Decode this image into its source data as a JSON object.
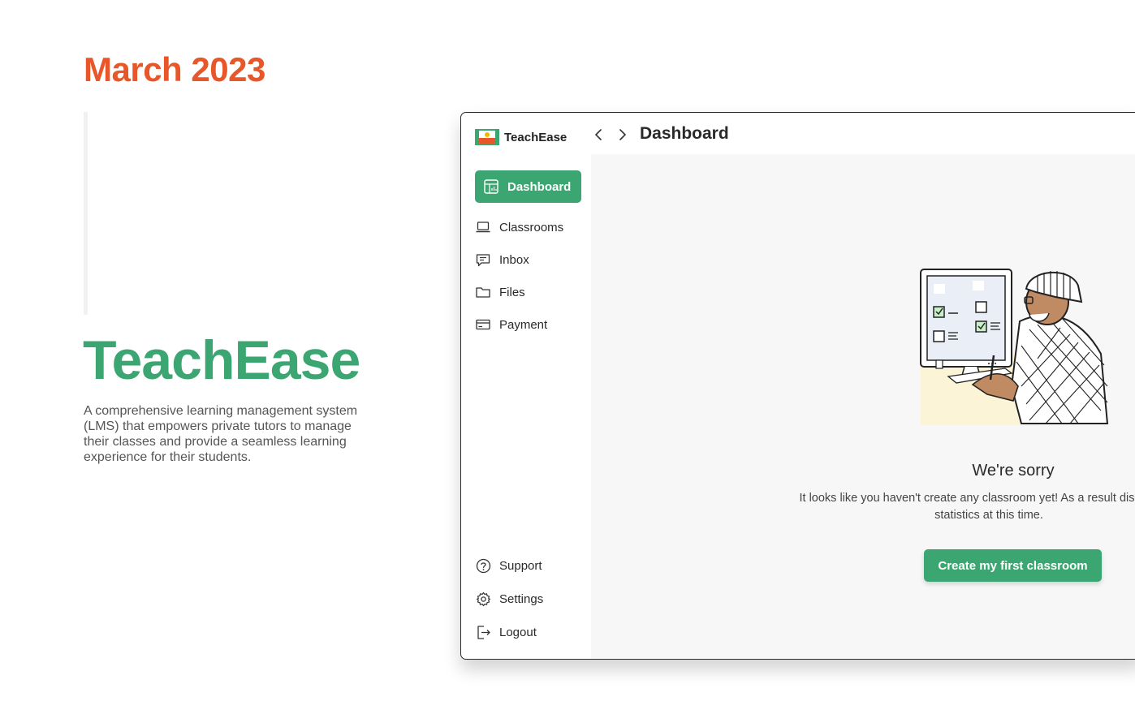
{
  "hero": {
    "date": "March 2023",
    "brand": "TeachEase",
    "description": "A comprehensive learning management system (LMS) that empowers private tutors to manage their classes and provide a seamless learning experience for their students."
  },
  "app": {
    "logo_name": "TeachEase",
    "page_title": "Dashboard",
    "sidebar": {
      "items": [
        {
          "label": "Dashboard",
          "icon": "dashboard-icon",
          "active": true
        },
        {
          "label": "Classrooms",
          "icon": "laptop-icon"
        },
        {
          "label": "Inbox",
          "icon": "chat-icon"
        },
        {
          "label": "Files",
          "icon": "folder-icon"
        },
        {
          "label": "Payment",
          "icon": "card-icon"
        }
      ],
      "bottom_items": [
        {
          "label": "Support",
          "icon": "help-icon"
        },
        {
          "label": "Settings",
          "icon": "gear-icon"
        },
        {
          "label": "Logout",
          "icon": "logout-icon"
        }
      ]
    },
    "empty_state": {
      "title": "We're sorry",
      "message": "It looks like you haven't create any classroom yet! As a result display any statistics at this time.",
      "cta_label": "Create my first classroom"
    }
  },
  "colors": {
    "accent": "#3BA672",
    "date": "#E8572A"
  }
}
